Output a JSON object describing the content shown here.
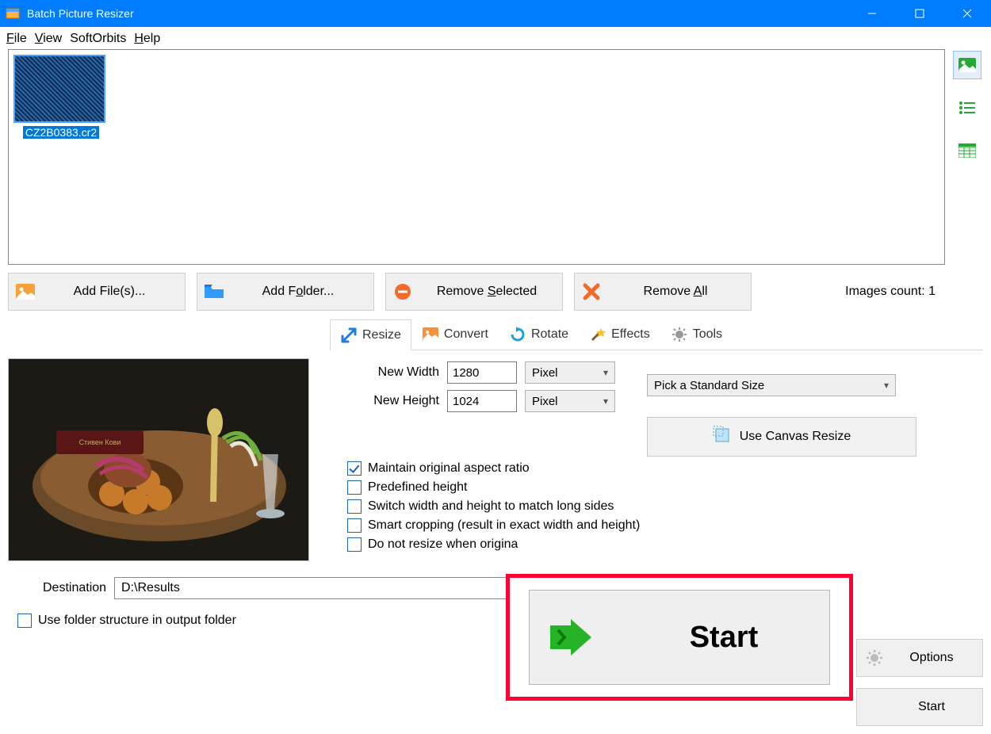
{
  "title": "Batch Picture Resizer",
  "menu": {
    "file": "File",
    "view": "View",
    "softorbits": "SoftOrbits",
    "help": "Help"
  },
  "thumb": {
    "filename": "CZ2B0383.cr2"
  },
  "actions": {
    "add_files": "Add File(s)...",
    "add_folder": "Add Folder...",
    "remove_selected": "Remove Selected",
    "remove_all": "Remove All"
  },
  "images_count_label": "Images count: 1",
  "tabs": {
    "resize": "Resize",
    "convert": "Convert",
    "rotate": "Rotate",
    "effects": "Effects",
    "tools": "Tools"
  },
  "resize": {
    "new_width_label": "New Width",
    "new_width_value": "1280",
    "new_width_unit": "Pixel",
    "new_height_label": "New Height",
    "new_height_value": "1024",
    "new_height_unit": "Pixel",
    "standard_size": "Pick a Standard Size",
    "canvas_btn": "Use Canvas Resize",
    "chk_aspect": "Maintain original aspect ratio",
    "chk_predef": "Predefined height",
    "chk_switch": "Switch width and height to match long sides",
    "chk_smart": "Smart cropping (result in exact width and height)",
    "chk_noresize": "Do not resize when origina"
  },
  "destination": {
    "label": "Destination",
    "value": "D:\\Results"
  },
  "folder_structure": "Use folder structure in output folder",
  "right": {
    "options": "Options",
    "start": "Start"
  },
  "big_start": "Start"
}
